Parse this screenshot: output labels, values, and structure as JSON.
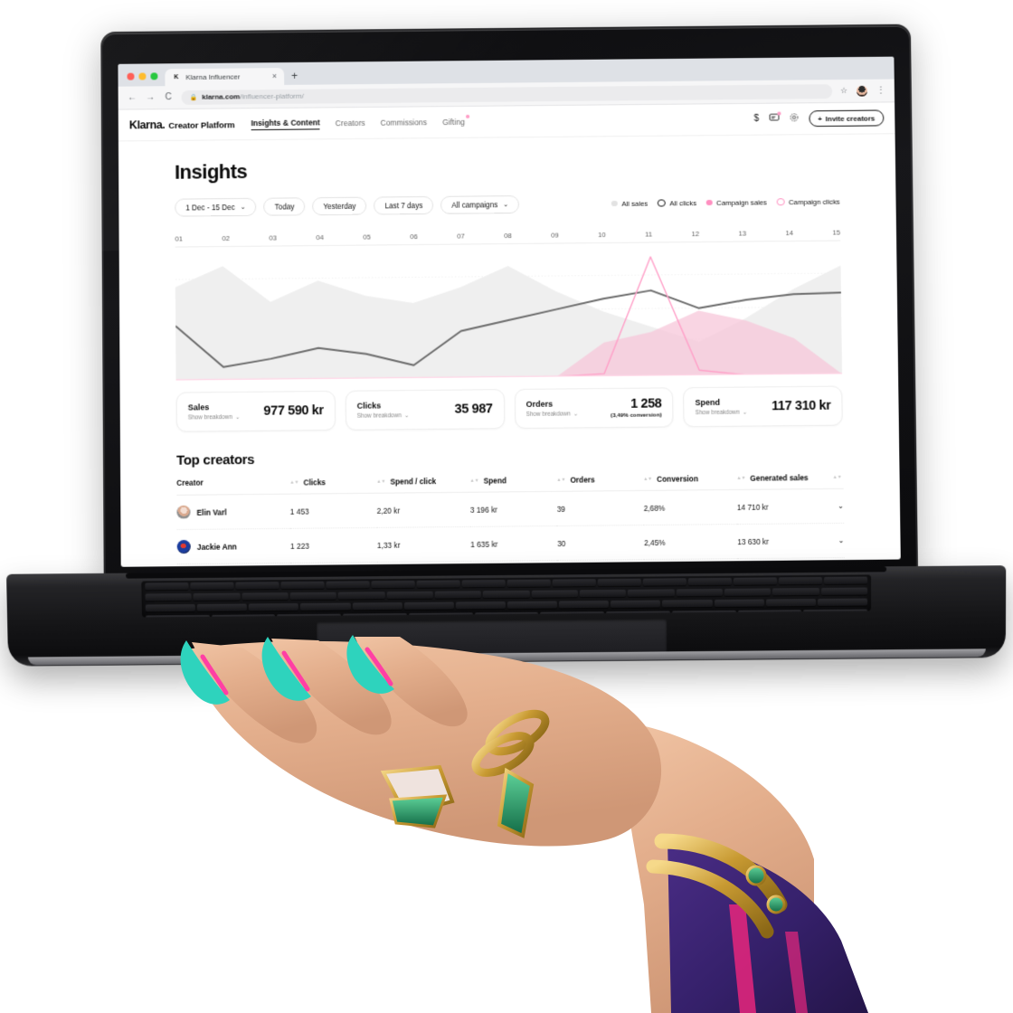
{
  "browser": {
    "tab": {
      "favicon": "klarna-k-icon",
      "title": "Klarna Influencer",
      "close": "×"
    },
    "new_tab": "+",
    "nav": {
      "back": "←",
      "forward": "→",
      "reload": "C"
    },
    "url_prefix": "klarna.com",
    "url_path": "/influencer-platform/",
    "lock_icon": "lock-icon",
    "star_icon": "star-icon",
    "menu_icon": "kebab-menu-icon"
  },
  "appnav": {
    "brand_name": "Klarna.",
    "brand_product": "Creator Platform",
    "links": [
      {
        "label": "Insights & Content",
        "active": true,
        "dot": false
      },
      {
        "label": "Creators",
        "active": false,
        "dot": false
      },
      {
        "label": "Commissions",
        "active": false,
        "dot": false
      },
      {
        "label": "Gifting",
        "active": false,
        "dot": true
      }
    ],
    "icons": [
      {
        "name": "dollar-icon",
        "glyph": "$",
        "badge": false
      },
      {
        "name": "messages-icon",
        "glyph": "▭",
        "badge": true
      },
      {
        "name": "settings-gear-icon",
        "glyph": "⚙",
        "badge": false
      }
    ],
    "invite_label": "Invite creators",
    "invite_plus": "+"
  },
  "page": {
    "title": "Insights",
    "filters": [
      {
        "label": "1 Dec - 15 Dec",
        "chevron": true
      },
      {
        "label": "Today",
        "chevron": false
      },
      {
        "label": "Yesterday",
        "chevron": false
      },
      {
        "label": "Last 7 days",
        "chevron": false
      },
      {
        "label": "All campaigns",
        "chevron": true
      }
    ],
    "legend": [
      {
        "label": "All sales",
        "style": "filled-gray",
        "color": "#e2e2e2"
      },
      {
        "label": "All clicks",
        "style": "ring-black",
        "color": "#111111"
      },
      {
        "label": "Campaign sales",
        "style": "filled-pink",
        "color": "#ff8fc0"
      },
      {
        "label": "Campaign clicks",
        "style": "ring-pink",
        "color": "#ff8fc0"
      }
    ]
  },
  "chart_data": {
    "type": "area",
    "title": "",
    "xlabel": "",
    "ylabel": "",
    "grid": true,
    "legend_position": "top-right",
    "x": [
      "01",
      "02",
      "03",
      "04",
      "05",
      "06",
      "07",
      "08",
      "09",
      "10",
      "11",
      "12",
      "13",
      "14",
      "15"
    ],
    "xlim": [
      1,
      15
    ],
    "ylim": [
      0,
      100
    ],
    "series": [
      {
        "name": "All sales",
        "type": "area",
        "color": "#efefef",
        "values": [
          72,
          88,
          60,
          76,
          64,
          58,
          70,
          86,
          66,
          50,
          38,
          26,
          44,
          66,
          84
        ]
      },
      {
        "name": "All clicks",
        "type": "line",
        "color": "#6b6b6b",
        "values": [
          42,
          10,
          16,
          24,
          19,
          10,
          36,
          44,
          52,
          60,
          66,
          52,
          58,
          62,
          63
        ]
      },
      {
        "name": "Campaign sales",
        "type": "area",
        "color": "#f7c7da",
        "values": [
          0,
          0,
          0,
          0,
          0,
          0,
          0,
          0,
          0,
          26,
          34,
          50,
          42,
          28,
          0
        ]
      },
      {
        "name": "Campaign clicks",
        "type": "line",
        "color": "#ff9ec7",
        "values": [
          0,
          0,
          0,
          0,
          0,
          0,
          0,
          0,
          0,
          2,
          92,
          4,
          0,
          0,
          0
        ]
      }
    ]
  },
  "stats": [
    {
      "label": "Sales",
      "breakdown": "Show breakdown",
      "value": "977 590 kr",
      "sub": ""
    },
    {
      "label": "Clicks",
      "breakdown": "Show breakdown",
      "value": "35 987",
      "sub": ""
    },
    {
      "label": "Orders",
      "breakdown": "Show breakdown",
      "value": "1 258",
      "sub": "(3,49% conversion)"
    },
    {
      "label": "Spend",
      "breakdown": "Show breakdown",
      "value": "117 310 kr",
      "sub": ""
    }
  ],
  "table": {
    "title": "Top creators",
    "columns": [
      "Creator",
      "Clicks",
      "Spend / click",
      "Spend",
      "Orders",
      "Conversion",
      "Generated sales"
    ],
    "rows": [
      {
        "name": "Elin Varl",
        "avatar": "avatar-elin",
        "clicks": "1 453",
        "spend_per_click": "2,20 kr",
        "spend": "3 196 kr",
        "orders": "39",
        "conversion": "2,68%",
        "generated_sales": "14 710 kr"
      },
      {
        "name": "Jackie Ann",
        "avatar": "avatar-jackie",
        "clicks": "1 223",
        "spend_per_click": "1,33 kr",
        "spend": "1 635 kr",
        "orders": "30",
        "conversion": "2,45%",
        "generated_sales": "13 630 kr"
      }
    ]
  }
}
